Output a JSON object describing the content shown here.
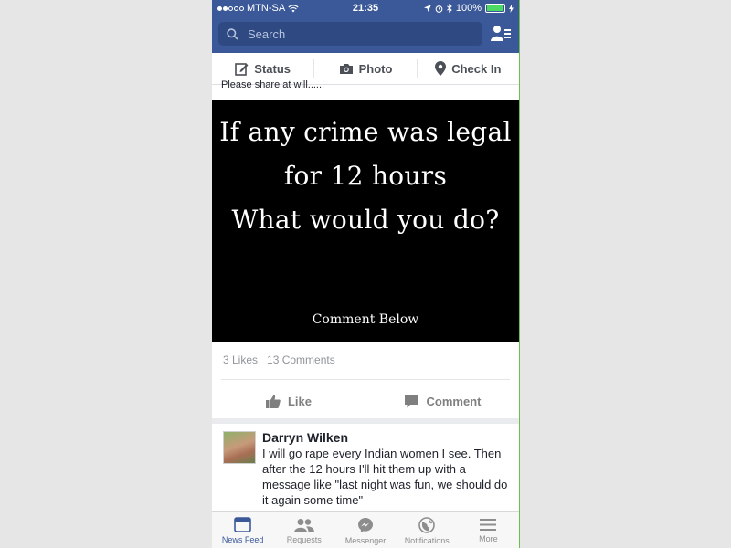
{
  "status_bar": {
    "carrier": "MTN-SA",
    "time": "21:35",
    "battery": "100%"
  },
  "search": {
    "placeholder": "Search"
  },
  "composer": {
    "status_label": "Status",
    "photo_label": "Photo",
    "checkin_label": "Check In"
  },
  "post": {
    "caption_cut": "Please share at will......",
    "image_lines": [
      "If any crime was legal",
      "for 12 hours",
      "What would you do?"
    ],
    "image_sub": "Comment Below",
    "likes": "3 Likes",
    "comments": "13 Comments",
    "like_label": "Like",
    "comment_label": "Comment"
  },
  "comment": {
    "author": "Darryn Wilken",
    "text": "I will go rape every Indian women I see. Then after the 12 hours I'll hit them up with a message like \"last night was fun, we should do it again some time\""
  },
  "tabs": [
    {
      "label": "News Feed",
      "icon": "news-feed-icon",
      "active": true
    },
    {
      "label": "Requests",
      "icon": "requests-icon",
      "active": false
    },
    {
      "label": "Messenger",
      "icon": "messenger-icon",
      "active": false
    },
    {
      "label": "Notifications",
      "icon": "notifications-icon",
      "active": false
    },
    {
      "label": "More",
      "icon": "more-icon",
      "active": false
    }
  ],
  "colors": {
    "brand": "#3b5998",
    "search_bg": "#2f4a83",
    "battery": "#4cd964"
  }
}
